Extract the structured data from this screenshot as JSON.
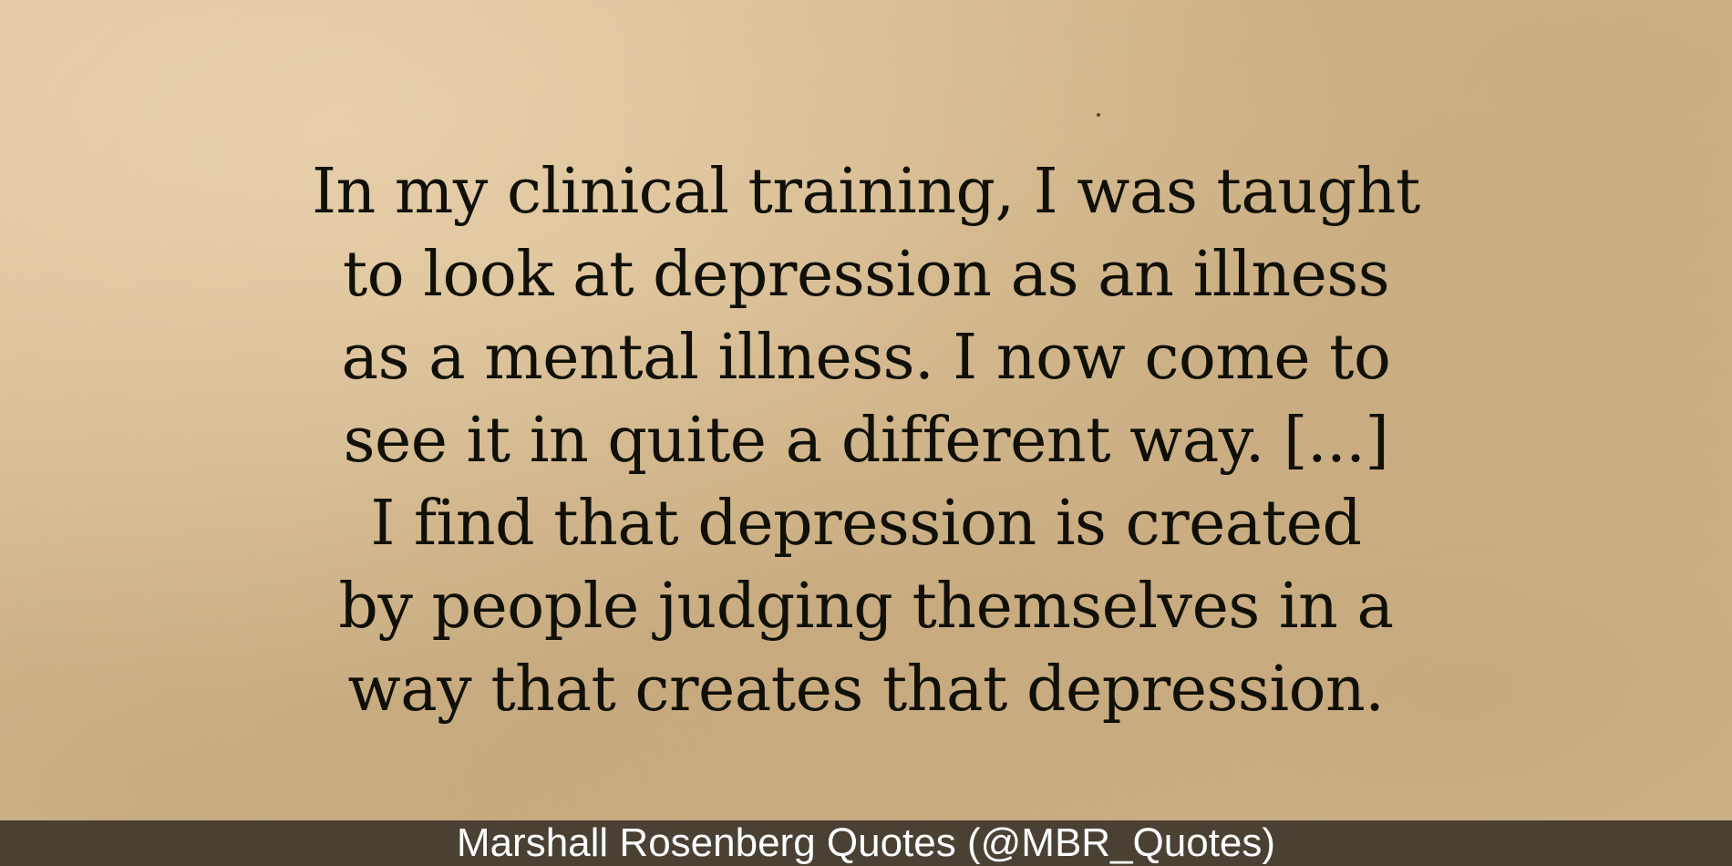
{
  "quote": {
    "lines": [
      "In my clinical training, I was taught",
      "to look at depression as an illness",
      "as a mental illness. I now come to",
      "see it in quite a different way. [...]",
      "I find that depression is created",
      "by people judging themselves in a",
      "way that creates that depression."
    ]
  },
  "attribution": {
    "text": "Marshall Rosenberg Quotes (@MBR_Quotes)"
  },
  "colors": {
    "paper": "#d8bd93",
    "text": "#111008",
    "bar": "#4a4034",
    "bar_text": "#ffffff"
  }
}
